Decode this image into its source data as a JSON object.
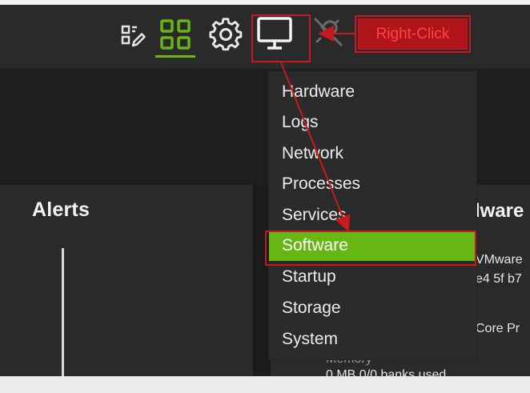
{
  "toolbar": {
    "icons": [
      {
        "name": "edit-layout-icon",
        "active": false
      },
      {
        "name": "dashboard-grid-icon",
        "active": true
      },
      {
        "name": "gear-icon",
        "active": false
      },
      {
        "name": "monitor-icon",
        "active": false
      },
      {
        "name": "unplug-icon",
        "active": false
      }
    ],
    "accent_color": "#66b614"
  },
  "annotations": {
    "callout_label": "Right-Click",
    "color": "#c8191f"
  },
  "context_menu": {
    "items": [
      {
        "label": "Hardware"
      },
      {
        "label": "Logs"
      },
      {
        "label": "Network"
      },
      {
        "label": "Processes"
      },
      {
        "label": "Services"
      },
      {
        "label": "Software"
      },
      {
        "label": "Startup"
      },
      {
        "label": "Storage"
      },
      {
        "label": "System"
      }
    ],
    "selected": "Software"
  },
  "alerts_card": {
    "title": "Alerts"
  },
  "hardware_card": {
    "title": "lware",
    "line1": "VMware",
    "line2": "e4 5f b7",
    "line3": "Core Pr",
    "memory_label": "Memory",
    "memory_value": "0 MB 0/0 banks used"
  }
}
